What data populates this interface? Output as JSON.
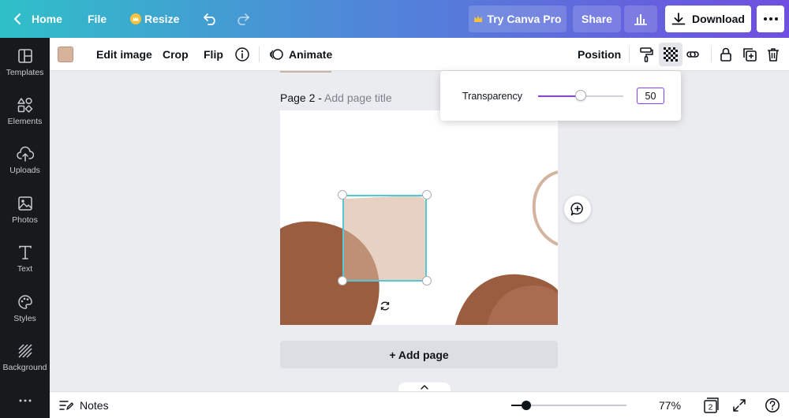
{
  "colors": {
    "topbar_gradient_start": "#2fc0c8",
    "topbar_gradient_end": "#6f4fe0",
    "accent": "#8b3dff",
    "selection": "#54c8d9",
    "shape_brown": "#9b5d40",
    "shape_tan": "#e5d6cc",
    "selected_fill": "#d6b39a"
  },
  "topbar": {
    "home_label": "Home",
    "file_label": "File",
    "resize_label": "Resize",
    "try_pro_label": "Try Canva Pro",
    "share_label": "Share",
    "download_label": "Download",
    "icons": [
      "chevron-left-icon",
      "crown-icon",
      "undo-icon",
      "redo-icon",
      "crown-icon",
      "bar-chart-icon",
      "download-icon",
      "more-icon"
    ]
  },
  "sidebar": {
    "items": [
      {
        "label": "Templates",
        "icon": "templates-icon"
      },
      {
        "label": "Elements",
        "icon": "elements-icon"
      },
      {
        "label": "Uploads",
        "icon": "uploads-icon"
      },
      {
        "label": "Photos",
        "icon": "photos-icon"
      },
      {
        "label": "Text",
        "icon": "text-icon"
      },
      {
        "label": "Styles",
        "icon": "styles-icon"
      },
      {
        "label": "Background",
        "icon": "background-icon"
      }
    ]
  },
  "toolbar": {
    "color_swatch": "#d6b39a",
    "edit_image_label": "Edit image",
    "crop_label": "Crop",
    "flip_label": "Flip",
    "animate_label": "Animate",
    "position_label": "Position",
    "icons": [
      "info-icon",
      "animate-icon",
      "paint-roller-icon",
      "transparency-icon",
      "link-icon",
      "lock-icon",
      "duplicate-icon",
      "trash-icon"
    ]
  },
  "canvas": {
    "page_prefix": "Page 2 - ",
    "page_title_placeholder": "Add page title",
    "add_page_label": "+ Add page"
  },
  "transparency_popup": {
    "label": "Transparency",
    "value": "50",
    "slider_fraction": 0.5
  },
  "bottombar": {
    "notes_label": "Notes",
    "zoom_label": "77%",
    "zoom_fraction": 0.13,
    "page_count": "2",
    "icons": [
      "notes-icon",
      "chevron-up-icon",
      "pages-icon",
      "fullscreen-icon",
      "help-icon"
    ]
  }
}
